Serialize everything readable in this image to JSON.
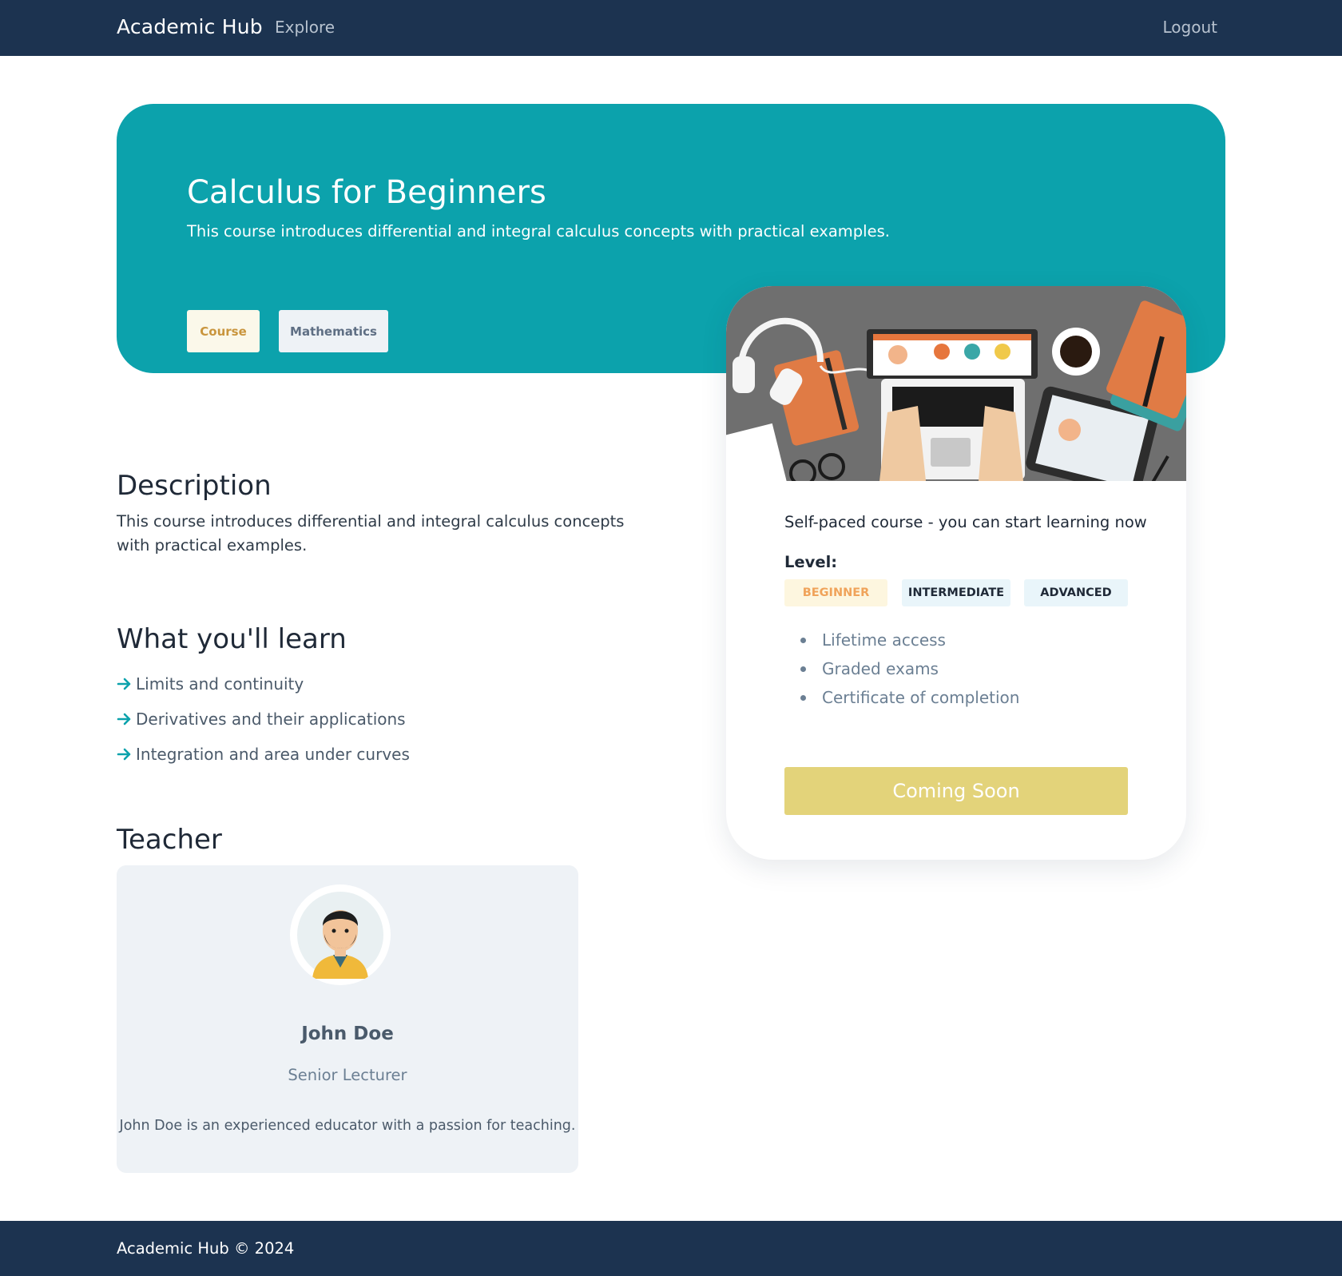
{
  "nav": {
    "brand": "Academic Hub",
    "explore": "Explore",
    "logout": "Logout"
  },
  "hero": {
    "title": "Calculus for Beginners",
    "subtitle": "This course introduces differential and integral calculus concepts with practical examples.",
    "tags": [
      "Course",
      "Mathematics"
    ]
  },
  "card": {
    "self_paced": "Self-paced course - you can start learning now",
    "level_label": "Level:",
    "levels": [
      "BEGINNER",
      "INTERMEDIATE",
      "ADVANCED"
    ],
    "selected_level": "BEGINNER",
    "features": [
      "Lifetime access",
      "Graded exams",
      "Certificate of completion"
    ],
    "cta_label": "Coming Soon"
  },
  "description": {
    "heading": "Description",
    "text": "This course introduces differential and integral calculus concepts with practical examples."
  },
  "learn": {
    "heading": "What you'll learn",
    "items": [
      "Limits and continuity",
      "Derivatives and their applications",
      "Integration and area under curves"
    ]
  },
  "teacher": {
    "heading": "Teacher",
    "name": "John Doe",
    "role": "Senior Lecturer",
    "bio": "John Doe is an experienced educator with a passion for teaching."
  },
  "footer": {
    "text": "Academic Hub © 2024"
  },
  "colors": {
    "nav_bg": "#1c3350",
    "hero_bg": "#0ca2ac",
    "cta_bg": "#e3d37a",
    "teacher_card_bg": "#eef2f6",
    "beginner_text": "#f0a35a"
  }
}
